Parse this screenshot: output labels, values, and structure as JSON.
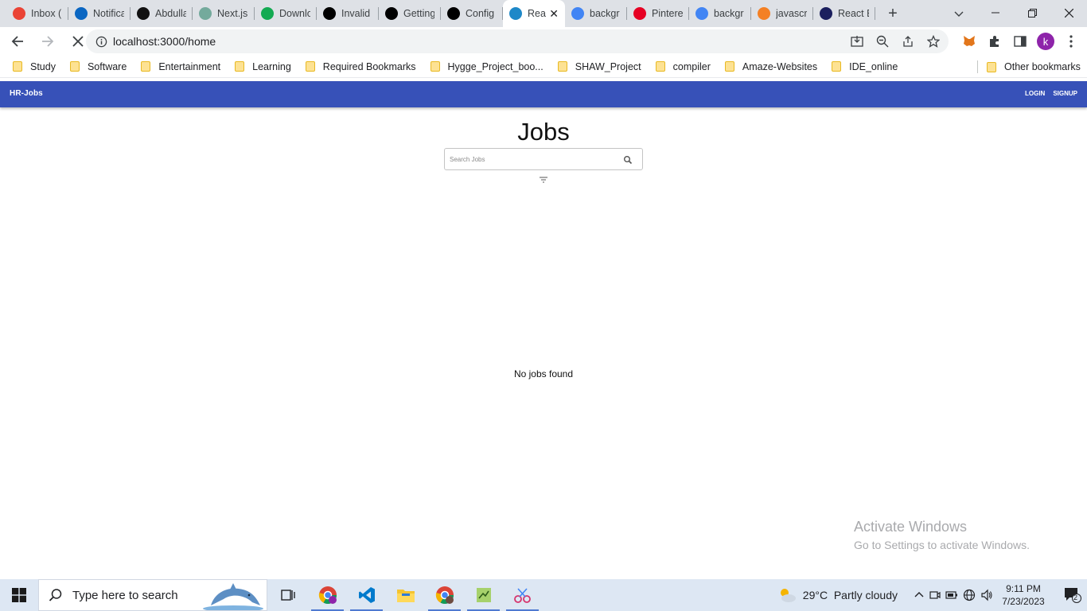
{
  "browser": {
    "tabs": [
      {
        "title": "Inbox (",
        "icon": "gmail-icon",
        "color": "#ea4335"
      },
      {
        "title": "Notifica",
        "icon": "linkedin-icon",
        "color": "#0a66c2"
      },
      {
        "title": "Abdulla",
        "icon": "github-icon",
        "color": "#111111"
      },
      {
        "title": "Next.js",
        "icon": "chatgpt-icon",
        "color": "#74aa9c"
      },
      {
        "title": "Downlo",
        "icon": "mongodb-icon",
        "color": "#13aa52"
      },
      {
        "title": "Invalid",
        "icon": "nextjs-icon",
        "color": "#000000"
      },
      {
        "title": "Getting",
        "icon": "nextjs-icon",
        "color": "#000000"
      },
      {
        "title": "Config",
        "icon": "nextjs-icon",
        "color": "#000000"
      },
      {
        "title": "Rea",
        "icon": "react-icon",
        "color": "#1e88c8",
        "active": true
      },
      {
        "title": "backgr",
        "icon": "google-icon",
        "color": "#4285f4"
      },
      {
        "title": "Pintere",
        "icon": "pinterest-icon",
        "color": "#e60023"
      },
      {
        "title": "backgr",
        "icon": "google-icon",
        "color": "#4285f4"
      },
      {
        "title": "javascr",
        "icon": "stackoverflow-icon",
        "color": "#f48024"
      },
      {
        "title": "React E",
        "icon": "react-editor-icon",
        "color": "#1b1f5e"
      }
    ],
    "url": "localhost:3000/home",
    "bookmarks": [
      "Study",
      "Software",
      "Entertainment",
      "Learning",
      "Required Bookmarks",
      "Hygge_Project_boo...",
      "SHAW_Project",
      "compiler",
      "Amaze-Websites",
      "IDE_online"
    ],
    "other_bookmarks": "Other bookmarks",
    "profile_initial": "k"
  },
  "app": {
    "brand": "HR-Jobs",
    "nav": {
      "login": "LOGIN",
      "signup": "SIGNUP"
    },
    "title": "Jobs",
    "search_placeholder": "Search Jobs",
    "empty_message": "No jobs found",
    "accent": "#3751b8"
  },
  "watermark": {
    "line1": "Activate Windows",
    "line2": "Go to Settings to activate Windows."
  },
  "taskbar": {
    "search_placeholder": "Type here to search",
    "weather": "29°C  Partly cloudy",
    "time": "9:11 PM",
    "date": "7/23/2023",
    "notifications": "2"
  }
}
